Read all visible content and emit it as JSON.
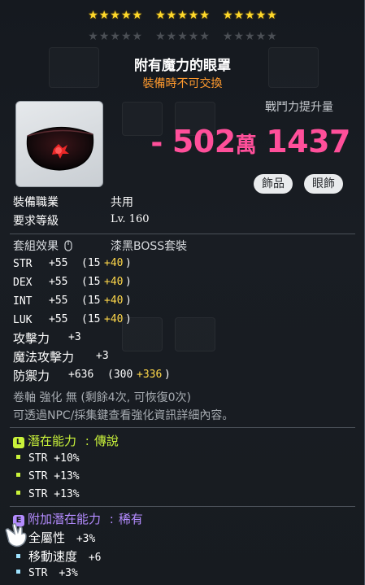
{
  "stars": {
    "gold_groups": 3,
    "per_group": 5,
    "dim_groups": 3
  },
  "item": {
    "name": "附有魔力的眼罩",
    "trade_note": "裝備時不可交換",
    "icon": "eye-patch-icon"
  },
  "combat": {
    "label": "戰鬥力提升量",
    "sign": "-",
    "value_a": "502",
    "unit": "萬",
    "value_b": "1437"
  },
  "tags": [
    "飾品",
    "眼飾"
  ],
  "info": [
    {
      "key": "裝備職業",
      "value": "共用"
    },
    {
      "key": "要求等級",
      "value": "Lv. 160"
    }
  ],
  "set": {
    "key": "套組效果",
    "value": "漆黑BOSS套裝"
  },
  "stats": [
    {
      "name": "STR",
      "value": "+55",
      "base": "(15",
      "bonus": "+40",
      "close": ")"
    },
    {
      "name": "DEX",
      "value": "+55",
      "base": "(15",
      "bonus": "+40",
      "close": ")"
    },
    {
      "name": "INT",
      "value": "+55",
      "base": "(15",
      "bonus": "+40",
      "close": ")"
    },
    {
      "name": "LUK",
      "value": "+55",
      "base": "(15",
      "bonus": "+40",
      "close": ")"
    }
  ],
  "attack": {
    "name": "攻擊力",
    "value": "+3"
  },
  "magic": {
    "name": "魔法攻擊力",
    "value": "+3"
  },
  "defense": {
    "name": "防禦力",
    "value": "+636",
    "base": "(300",
    "bonus": "+336",
    "close": ")"
  },
  "scroll": {
    "line1": "卷軸 強化 無 (剩餘4次, 可恢復0次)",
    "line2": "可透過NPC/採集鍵查看強化資訊詳細內容。"
  },
  "potential": {
    "badge": "L",
    "label": "潛在能力",
    "colon": ":",
    "grade": "傳說",
    "color": "#c9f23a",
    "lines": [
      "STR +10%",
      "STR +13%",
      "STR +13%"
    ]
  },
  "bonus_potential": {
    "badge": "E",
    "label": "附加潛在能力",
    "colon": ":",
    "grade": "稀有",
    "color": "#b48cff",
    "bullet_color": "#9fe3ff",
    "lines": [
      {
        "name": "全屬性",
        "value": "+3%"
      },
      {
        "name": "移動速度",
        "value": "+6"
      },
      {
        "name": "STR",
        "value": "+3%"
      }
    ]
  }
}
